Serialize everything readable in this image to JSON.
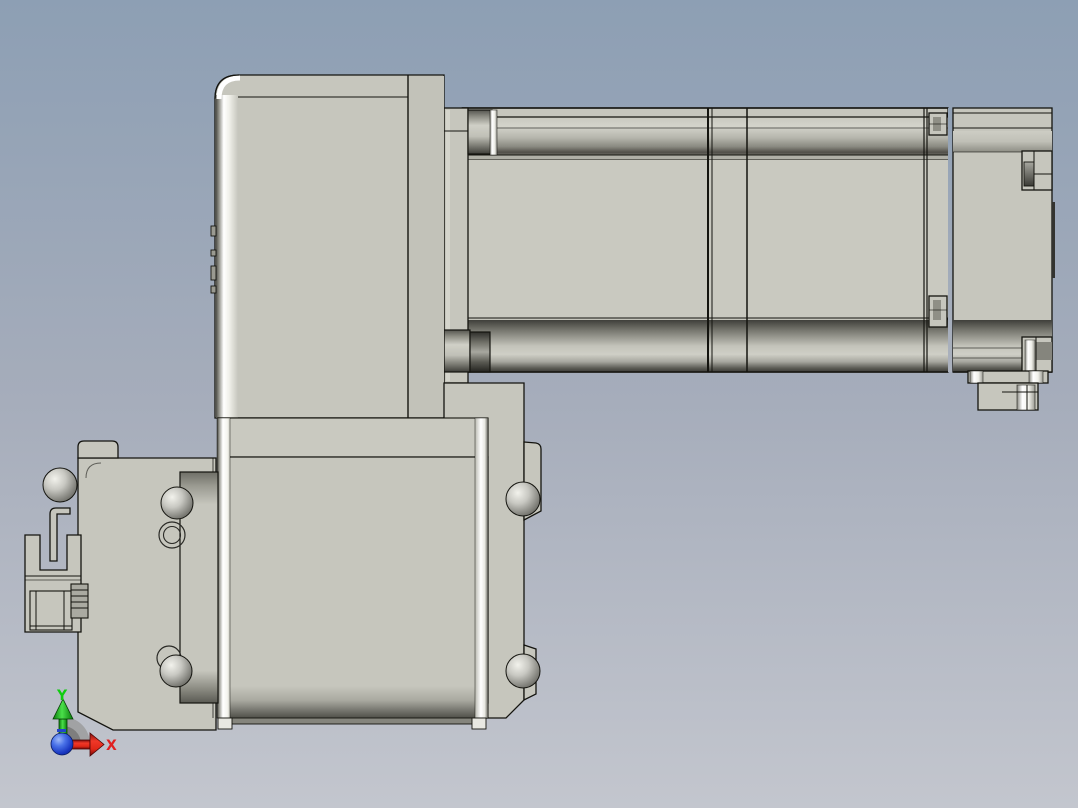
{
  "axis_triad": {
    "x_label": "X",
    "y_label": "Y"
  },
  "colors": {
    "bg_top": "#8d9fb4",
    "bg_mid": "#a6adbb",
    "bg_bottom": "#c3c6ce",
    "part": "#c6c6bd",
    "part_light": "#cdcdc4",
    "part_dark": "#aaaaa1",
    "outline": "#14140f",
    "highlight": "#ffffff",
    "shadow": "#3a3a35",
    "metal_light": "#f2f2ec",
    "metal_dark": "#5e5e58",
    "axis_x_red": "#e82010",
    "axis_y_green": "#1cc41c",
    "origin_blue": "#1836c0",
    "axis_label_red": "#e02020",
    "axis_label_green": "#10cc10"
  }
}
